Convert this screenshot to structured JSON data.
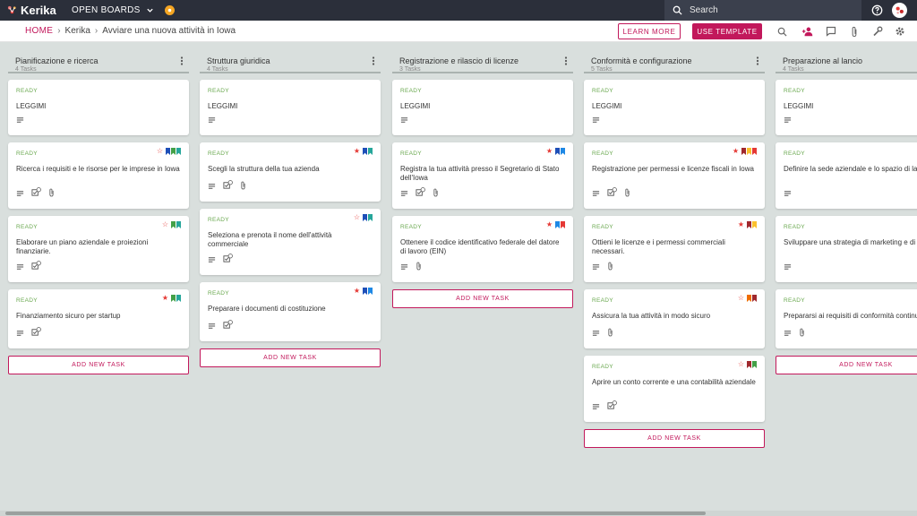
{
  "app": {
    "name": "Kerika",
    "open_boards_label": "OPEN BOARDS"
  },
  "search": {
    "placeholder": "Search"
  },
  "breadcrumb": {
    "home": "HOME",
    "workspace": "Kerika",
    "board": "Avviare una nuova attività in Iowa"
  },
  "actions": {
    "learn_more": "LEARN MORE",
    "use_template": "USE TEMPLATE"
  },
  "colors": {
    "accent": "#c2185b",
    "ready": "#6aa84f",
    "topbar": "#2b2f3a",
    "board_bg": "#d9dfdd"
  },
  "add_task_label": "ADD NEW TASK",
  "columns": [
    {
      "title": "Pianificazione e ricerca",
      "count": "4 Tasks",
      "cards": [
        {
          "status": "READY",
          "title": "LEGGIMI",
          "star": "",
          "flags": [],
          "icons": [
            "description"
          ]
        },
        {
          "status": "READY",
          "title": "Ricerca i requisiti e le risorse per le imprese in Iowa",
          "star": "empty",
          "flags": [
            "#1e4fb8",
            "#43a047",
            "#26a69a"
          ],
          "icons": [
            "description",
            "checklist",
            "attachment"
          ],
          "checklist_count": "3"
        },
        {
          "status": "READY",
          "title": "Elaborare un piano aziendale e proiezioni finanziarie.",
          "star": "empty",
          "flags": [
            "#43a047",
            "#26a69a"
          ],
          "icons": [
            "description",
            "checklist"
          ],
          "checklist_count": "3"
        },
        {
          "status": "READY",
          "title": "Finanziamento sicuro per startup",
          "star": "filled",
          "flags": [
            "#43a047",
            "#26a69a"
          ],
          "icons": [
            "description",
            "checklist"
          ],
          "checklist_count": "3"
        }
      ]
    },
    {
      "title": "Struttura giuridica",
      "count": "4 Tasks",
      "cards": [
        {
          "status": "READY",
          "title": "LEGGIMI",
          "star": "",
          "flags": [],
          "icons": [
            "description"
          ]
        },
        {
          "status": "READY",
          "title": "Scegli la struttura della tua azienda",
          "star": "filled",
          "flags": [
            "#1e4fb8",
            "#26a69a"
          ],
          "icons": [
            "description",
            "checklist",
            "attachment"
          ],
          "checklist_count": "3"
        },
        {
          "status": "READY",
          "title": "Seleziona e prenota il nome dell'attività commerciale",
          "star": "empty",
          "flags": [
            "#1e4fb8",
            "#26a69a"
          ],
          "icons": [
            "description",
            "checklist"
          ],
          "checklist_count": "3"
        },
        {
          "status": "READY",
          "title": "Preparare i documenti di costituzione",
          "star": "filled",
          "flags": [
            "#1e4fb8",
            "#1e88e5"
          ],
          "icons": [
            "description",
            "checklist"
          ],
          "checklist_count": "3"
        }
      ]
    },
    {
      "title": "Registrazione e rilascio di licenze",
      "count": "3 Tasks",
      "cards": [
        {
          "status": "READY",
          "title": "LEGGIMI",
          "star": "",
          "flags": [],
          "icons": [
            "description"
          ]
        },
        {
          "status": "READY",
          "title": "Registra la tua attività presso il Segretario di Stato dell'Iowa",
          "star": "filled",
          "flags": [
            "#1e4fb8",
            "#1e88e5"
          ],
          "icons": [
            "description",
            "checklist",
            "attachment"
          ],
          "checklist_count": "3"
        },
        {
          "status": "READY",
          "title": "Ottenere il codice identificativo federale del datore di lavoro (EIN)",
          "star": "filled",
          "flags": [
            "#1e88e5",
            "#e53935"
          ],
          "icons": [
            "description",
            "attachment"
          ]
        }
      ]
    },
    {
      "title": "Conformità e configurazione",
      "count": "5 Tasks",
      "cards": [
        {
          "status": "READY",
          "title": "LEGGIMI",
          "star": "",
          "flags": [],
          "icons": [
            "description"
          ]
        },
        {
          "status": "READY",
          "title": "Registrazione per permessi e licenze fiscali in Iowa",
          "star": "filled",
          "flags": [
            "#a0282d",
            "#fbc02d",
            "#e53935"
          ],
          "icons": [
            "description",
            "checklist",
            "attachment"
          ],
          "checklist_count": "3"
        },
        {
          "status": "READY",
          "title": "Ottieni le licenze e i permessi commerciali necessari.",
          "star": "filled",
          "flags": [
            "#a0282d",
            "#fbc02d"
          ],
          "icons": [
            "description",
            "attachment"
          ]
        },
        {
          "status": "READY",
          "title": "Assicura la tua attività in modo sicuro",
          "star": "empty",
          "flags": [
            "#ef6c00",
            "#a0282d"
          ],
          "icons": [
            "description",
            "attachment"
          ]
        },
        {
          "status": "READY",
          "title": "Aprire un conto corrente e una contabilità aziendale",
          "star": "empty",
          "flags": [
            "#a0282d",
            "#43a047"
          ],
          "icons": [
            "description",
            "checklist"
          ],
          "checklist_count": "3"
        }
      ]
    },
    {
      "title": "Preparazione al lancio",
      "count": "4 Tasks",
      "cards": [
        {
          "status": "READY",
          "title": "LEGGIMI",
          "star": "",
          "flags": [],
          "icons": [
            "description"
          ]
        },
        {
          "status": "READY",
          "title": "Definire la sede aziendale e lo spazio di lavoro",
          "star": "",
          "flags": [],
          "icons": [
            "description"
          ]
        },
        {
          "status": "READY",
          "title": "Sviluppare una strategia di marketing e di branding",
          "star": "",
          "flags": [],
          "icons": [
            "description"
          ]
        },
        {
          "status": "READY",
          "title": "Prepararsi ai requisiti di conformità continui",
          "star": "",
          "flags": [],
          "icons": [
            "description",
            "attachment"
          ]
        }
      ]
    }
  ]
}
